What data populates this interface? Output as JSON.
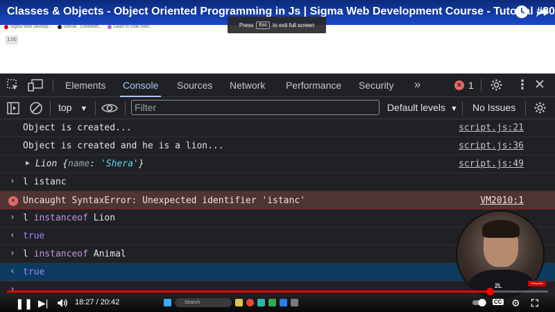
{
  "video": {
    "title": "Classes & Objects - Object Oriented Programming in Js | Sigma Web Development Course - Tutorial #80",
    "fullscreen_notice_pre": "Press",
    "fullscreen_notice_key": "Esc",
    "fullscreen_notice_post": "to exit full screen",
    "speed_badge": "1.00",
    "time_display": "18:27 / 20:42",
    "progress": 0.892,
    "cc_label": "CC"
  },
  "bookmarks": [
    {
      "label": "Sigma Web Develop..."
    },
    {
      "label": "GitHub · CodeWith..."
    },
    {
      "label": "Learn to code onlin..."
    }
  ],
  "devtools": {
    "tabs": [
      {
        "label": "Elements",
        "active": false
      },
      {
        "label": "Console",
        "active": true
      },
      {
        "label": "Sources",
        "active": false
      },
      {
        "label": "Network",
        "active": false
      },
      {
        "label": "Performance",
        "active": false
      },
      {
        "label": "Security",
        "active": false
      }
    ],
    "error_count": "1",
    "context": "top",
    "filter_placeholder": "Filter",
    "levels": "Default levels",
    "issues": "No Issues"
  },
  "console": {
    "rows": [
      {
        "text": "Object is created...",
        "source": "script.js:21"
      },
      {
        "text": "Object is created and he is a lion...",
        "source": "script.js:36"
      },
      {
        "class_name": "Lion",
        "obj_key": "name",
        "obj_val": "'Shera'",
        "source": "script.js:49"
      },
      {
        "text": "l istanc"
      },
      {
        "text": "Uncaught SyntaxError: Unexpected identifier 'istanc'",
        "source": "VM2010:1"
      },
      {
        "pre": "l ",
        "kw": "instanceof",
        "post": " Lion"
      },
      {
        "result": "true"
      },
      {
        "pre": "l ",
        "kw": "instanceof",
        "post": " Animal"
      },
      {
        "result": "true"
      }
    ]
  },
  "colors": {
    "devtools_bg": "#202124",
    "accent": "#a8c7fa",
    "error_bg": "#4e3534",
    "keyword": "#c792ea",
    "result": "#9e85ff",
    "progress": "#ff0000"
  },
  "taskbar": {
    "search_label": "Search"
  },
  "cam": {
    "shirt_text": "2L"
  },
  "subscribe_label": "Subscribe"
}
